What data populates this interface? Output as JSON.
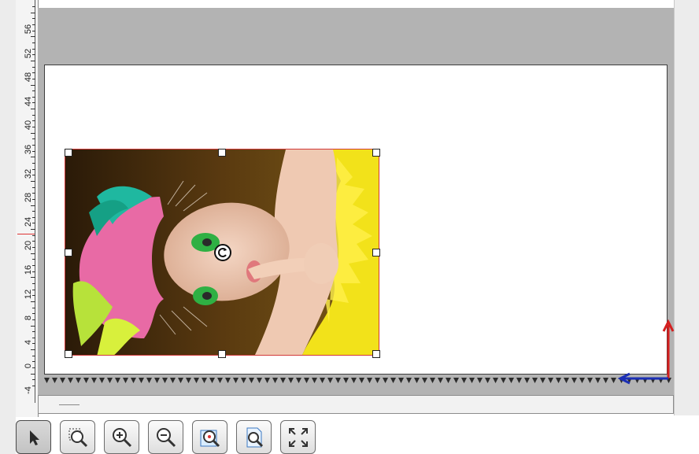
{
  "ruler": {
    "labels": [
      "-4",
      "0",
      "4",
      "8",
      "12",
      "16",
      "20",
      "24",
      "28",
      "32",
      "36",
      "40",
      "44",
      "48",
      "52",
      "56"
    ]
  },
  "canvas": {
    "selection_color": "#d23a3a",
    "paper_color": "#ffffff",
    "workspace_color": "#b3b3b3"
  },
  "image": {
    "subject": "photo of a person with pink and green hair, green eye makeup, yellow feathers, finger to lips"
  },
  "axes": {
    "x_color": "#1b2fb5",
    "y_color": "#d41f1f"
  },
  "toolbar": {
    "tools": [
      {
        "name": "select-tool",
        "icon": "arrow-pointer-icon",
        "active": true
      },
      {
        "name": "zoom-region-tool",
        "icon": "zoom-region-icon",
        "active": false
      },
      {
        "name": "zoom-in-tool",
        "icon": "zoom-in-icon",
        "active": false
      },
      {
        "name": "zoom-out-tool",
        "icon": "zoom-out-icon",
        "active": false
      },
      {
        "name": "zoom-selection-tool",
        "icon": "zoom-selection-icon",
        "active": false
      },
      {
        "name": "zoom-page-tool",
        "icon": "zoom-page-icon",
        "active": false
      },
      {
        "name": "fit-to-window-tool",
        "icon": "expand-arrows-icon",
        "active": false
      }
    ]
  }
}
